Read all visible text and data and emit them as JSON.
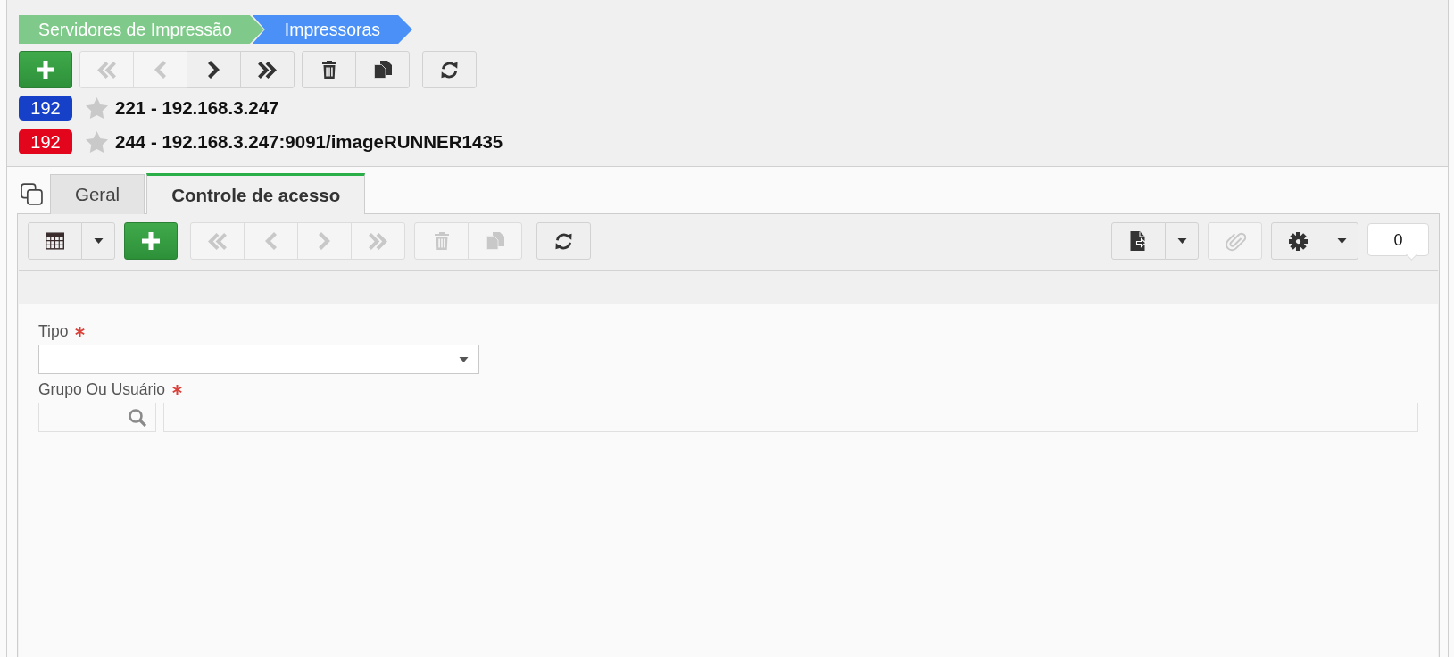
{
  "breadcrumb": [
    {
      "label": "Servidores de Impressão",
      "selected": false
    },
    {
      "label": "Impressoras",
      "selected": true
    }
  ],
  "toolbar": {
    "groups": [
      {
        "buttons": [
          {
            "kind": "add",
            "disabled": false
          }
        ]
      },
      {
        "buttons": [
          {
            "kind": "first",
            "disabled": true
          },
          {
            "kind": "previous",
            "disabled": true
          },
          {
            "kind": "next",
            "disabled": false
          },
          {
            "kind": "last",
            "disabled": false
          }
        ]
      },
      {
        "buttons": [
          {
            "kind": "delete",
            "disabled": false
          },
          {
            "kind": "copy",
            "disabled": false
          }
        ]
      },
      {
        "buttons": [
          {
            "kind": "refresh",
            "disabled": false
          }
        ]
      }
    ]
  },
  "records": [
    {
      "badge": "192",
      "color": "#1740c8",
      "starred": false,
      "title": "221 - 192.168.3.247"
    },
    {
      "badge": "192",
      "color": "#e3051b",
      "starred": false,
      "title": "244 - 192.168.3.247:9091/imageRUNNER1435"
    }
  ],
  "tabs": [
    {
      "label": "Geral",
      "selected": false
    },
    {
      "label": "Controle de acesso",
      "selected": true
    }
  ],
  "panel_toolbar": {
    "left": [
      {
        "buttons": [
          {
            "kind": "grid",
            "disabled": false
          },
          {
            "kind": "dropdown",
            "disabled": false
          }
        ]
      },
      {
        "buttons": [
          {
            "kind": "add",
            "disabled": false
          }
        ]
      },
      {
        "buttons": [
          {
            "kind": "first",
            "disabled": true
          },
          {
            "kind": "previous",
            "disabled": true
          },
          {
            "kind": "next",
            "disabled": true
          },
          {
            "kind": "last",
            "disabled": true
          }
        ]
      },
      {
        "buttons": [
          {
            "kind": "delete",
            "disabled": true
          },
          {
            "kind": "copy",
            "disabled": true
          }
        ]
      },
      {
        "buttons": [
          {
            "kind": "refresh",
            "disabled": false
          }
        ]
      }
    ],
    "right": [
      {
        "buttons": [
          {
            "kind": "export",
            "disabled": false
          },
          {
            "kind": "dropdown",
            "disabled": false
          }
        ]
      },
      {
        "buttons": [
          {
            "kind": "attach",
            "disabled": true
          }
        ]
      },
      {
        "buttons": [
          {
            "kind": "settings",
            "disabled": false
          },
          {
            "kind": "dropdown",
            "disabled": false
          }
        ]
      }
    ],
    "counter": "0"
  },
  "form": [
    {
      "kind": "select",
      "label": "Tipo",
      "required": true
    },
    {
      "kind": "lookup",
      "label": "Grupo Ou Usuário",
      "required": true
    }
  ]
}
